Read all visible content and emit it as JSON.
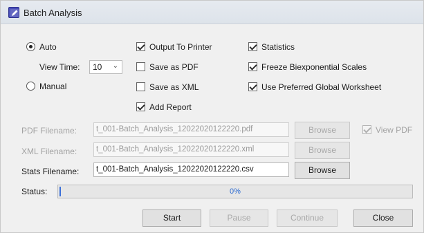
{
  "window": {
    "title": "Batch Analysis",
    "accent": "#4a4fb8"
  },
  "mode": {
    "auto_label": "Auto",
    "manual_label": "Manual",
    "selected": "auto",
    "view_time_label": "View Time:",
    "view_time_value": "10"
  },
  "options": {
    "output_to_printer": {
      "label": "Output To Printer",
      "checked": true
    },
    "save_as_pdf": {
      "label": "Save as PDF",
      "checked": false
    },
    "save_as_xml": {
      "label": "Save as XML",
      "checked": false
    },
    "add_report": {
      "label": "Add Report",
      "checked": true
    },
    "statistics": {
      "label": "Statistics",
      "checked": true
    },
    "freeze_scales": {
      "label": "Freeze Biexponential Scales",
      "checked": true
    },
    "use_global_worksheet": {
      "label": "Use Preferred Global Worksheet",
      "checked": true
    }
  },
  "files": {
    "pdf_label": "PDF Filename:",
    "pdf_value": "t_001-Batch_Analysis_12022020122220.pdf",
    "xml_label": "XML Filename:",
    "xml_value": "t_001-Batch_Analysis_12022020122220.xml",
    "stats_label": "Stats Filename:",
    "stats_value": "t_001-Batch_Analysis_12022020122220.csv",
    "browse_label": "Browse",
    "view_pdf_label": "View PDF",
    "view_pdf_checked": true
  },
  "status": {
    "label": "Status:",
    "progress_text": "0%",
    "progress_fraction": 0
  },
  "buttons": {
    "start": "Start",
    "pause": "Pause",
    "continue": "Continue",
    "close": "Close"
  }
}
